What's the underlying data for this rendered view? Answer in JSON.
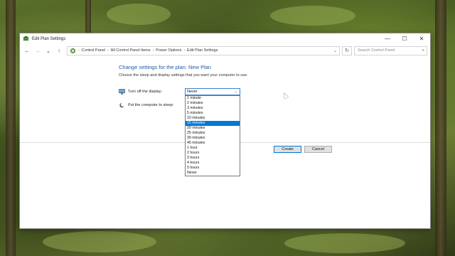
{
  "window": {
    "title": "Edit Plan Settings",
    "controls": {
      "minimize": "—",
      "maximize": "☐",
      "close": "✕"
    }
  },
  "navbar": {
    "back": "←",
    "forward": "→",
    "recent": "⌄",
    "up": "↑",
    "breadcrumbs": [
      "Control Panel",
      "All Control Panel Items",
      "Power Options",
      "Edit Plan Settings"
    ],
    "separator": "›",
    "address_dropdown": "⌄",
    "refresh": "↻",
    "search_placeholder": "Search Control Panel",
    "search_icon": "⌕"
  },
  "main": {
    "heading": "Change settings for the plan: New Plan",
    "subtext": "Choose the sleep and display settings that you want your computer to use.",
    "display_label": "Turn off the display:",
    "sleep_label": "Put the computer to sleep:",
    "display_value": "Never",
    "dropdown_chevron": "⌄"
  },
  "dropdown_options": [
    "1 minute",
    "2 minutes",
    "3 minutes",
    "5 minutes",
    "10 minutes",
    "15 minutes",
    "20 minutes",
    "25 minutes",
    "30 minutes",
    "45 minutes",
    "1 hour",
    "2 hours",
    "3 hours",
    "4 hours",
    "5 hours",
    "Never"
  ],
  "highlighted_option": "15 minutes",
  "buttons": {
    "create": "Create",
    "cancel": "Cancel"
  },
  "colors": {
    "accent": "#0078d7",
    "heading": "#1e5ca8",
    "selection": "#0078d7"
  }
}
